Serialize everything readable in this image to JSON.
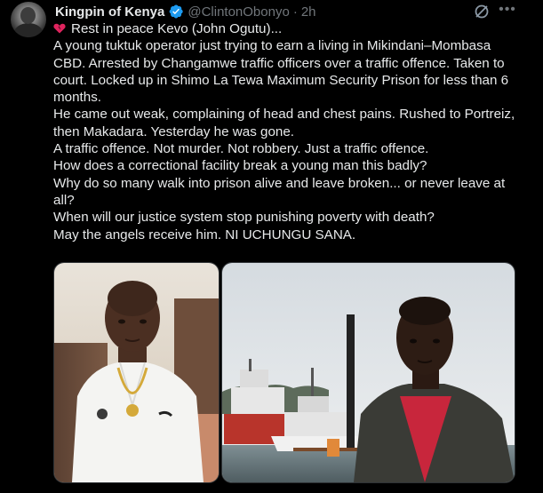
{
  "author": {
    "display_name": "Kingpin of Kenya",
    "handle": "@ClintonObonyo",
    "separator": "·",
    "time": "2h"
  },
  "icons": {
    "verified": "verified-badge-icon",
    "grok": "grok-icon",
    "more": "more-options-icon",
    "heart": "broken-heart-icon"
  },
  "colors": {
    "background": "#000000",
    "text": "#e7e9ea",
    "muted": "#71767b",
    "verified": "#1d9bf0",
    "heart": "#e0245e"
  },
  "tweet": {
    "lines": [
      "Rest in peace Kevo (John Ogutu)...",
      "A young tuktuk operator just trying to earn a living in Mikindani–Mombasa CBD. Arrested by Changamwe traffic officers over a traffic offence. Taken to court. Locked up in Shimo La Tewa Maximum Security Prison for less than 6 months.",
      "He came out weak, complaining of head and chest pains. Rushed to Portreiz, then Makadara. Yesterday he was gone.",
      "A traffic offence. Not murder. Not robbery. Just a traffic offence.",
      "How does a correctional facility break a young man this badly?",
      "Why do so many walk into prison alive and leave broken... or never leave at all?",
      "When will our justice system stop punishing poverty with death?",
      "May the angels receive him. NI UCHUNGU SANA."
    ]
  },
  "media": {
    "left_photo": "man-in-white-shirt-photo",
    "right_photo": "man-at-harbour-with-ships-photo"
  }
}
